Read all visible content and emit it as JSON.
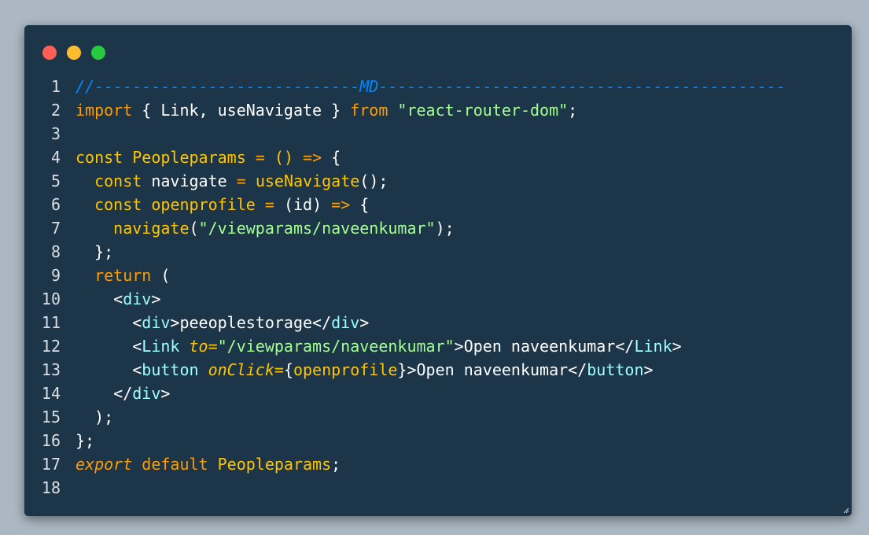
{
  "window": {
    "controls": [
      "close",
      "minimize",
      "maximize"
    ],
    "colors": {
      "background": "#1c3549",
      "page": "#abb8c3"
    }
  },
  "code": {
    "lines": [
      {
        "n": "1",
        "tokens": [
          {
            "t": "//----------------------------MD-------------------------------------------",
            "c": "comment"
          }
        ]
      },
      {
        "n": "2",
        "tokens": [
          {
            "t": "import",
            "c": "keyword"
          },
          {
            "t": " { Link, useNavigate } ",
            "c": "plain"
          },
          {
            "t": "from",
            "c": "keyword"
          },
          {
            "t": " ",
            "c": "plain"
          },
          {
            "t": "\"react-router-dom\"",
            "c": "string"
          },
          {
            "t": ";",
            "c": "plain"
          }
        ]
      },
      {
        "n": "3",
        "tokens": []
      },
      {
        "n": "4",
        "tokens": [
          {
            "t": "const",
            "c": "func"
          },
          {
            "t": " ",
            "c": "plain"
          },
          {
            "t": "Peopleparams",
            "c": "func"
          },
          {
            "t": " ",
            "c": "plain"
          },
          {
            "t": "=",
            "c": "op"
          },
          {
            "t": " () ",
            "c": "func"
          },
          {
            "t": "=>",
            "c": "op"
          },
          {
            "t": " {",
            "c": "plain"
          }
        ]
      },
      {
        "n": "5",
        "tokens": [
          {
            "t": "  ",
            "c": "plain"
          },
          {
            "t": "const",
            "c": "func"
          },
          {
            "t": " navigate ",
            "c": "plain"
          },
          {
            "t": "=",
            "c": "op"
          },
          {
            "t": " ",
            "c": "plain"
          },
          {
            "t": "useNavigate",
            "c": "func"
          },
          {
            "t": "();",
            "c": "plain"
          }
        ]
      },
      {
        "n": "6",
        "tokens": [
          {
            "t": "  ",
            "c": "plain"
          },
          {
            "t": "const",
            "c": "func"
          },
          {
            "t": " ",
            "c": "plain"
          },
          {
            "t": "openprofile",
            "c": "func"
          },
          {
            "t": " ",
            "c": "plain"
          },
          {
            "t": "=",
            "c": "op"
          },
          {
            "t": " (id) ",
            "c": "plain"
          },
          {
            "t": "=>",
            "c": "op"
          },
          {
            "t": " {",
            "c": "plain"
          }
        ]
      },
      {
        "n": "7",
        "tokens": [
          {
            "t": "    ",
            "c": "plain"
          },
          {
            "t": "navigate",
            "c": "func"
          },
          {
            "t": "(",
            "c": "plain"
          },
          {
            "t": "\"/viewparams/naveenkumar\"",
            "c": "string"
          },
          {
            "t": ");",
            "c": "plain"
          }
        ]
      },
      {
        "n": "8",
        "tokens": [
          {
            "t": "  };",
            "c": "plain"
          }
        ]
      },
      {
        "n": "9",
        "tokens": [
          {
            "t": "  ",
            "c": "plain"
          },
          {
            "t": "return",
            "c": "keyword"
          },
          {
            "t": " (",
            "c": "plain"
          }
        ]
      },
      {
        "n": "10",
        "tokens": [
          {
            "t": "    <",
            "c": "plain"
          },
          {
            "t": "div",
            "c": "tag"
          },
          {
            "t": ">",
            "c": "plain"
          }
        ]
      },
      {
        "n": "11",
        "tokens": [
          {
            "t": "      <",
            "c": "plain"
          },
          {
            "t": "div",
            "c": "tag"
          },
          {
            "t": ">peeoplestorage</",
            "c": "plain"
          },
          {
            "t": "div",
            "c": "tag"
          },
          {
            "t": ">",
            "c": "plain"
          }
        ]
      },
      {
        "n": "12",
        "tokens": [
          {
            "t": "      <",
            "c": "plain"
          },
          {
            "t": "Link",
            "c": "tag"
          },
          {
            "t": " ",
            "c": "plain"
          },
          {
            "t": "to=",
            "c": "attr"
          },
          {
            "t": "\"/viewparams/naveenkumar\"",
            "c": "string"
          },
          {
            "t": ">Open naveenkumar</",
            "c": "plain"
          },
          {
            "t": "Link",
            "c": "tag"
          },
          {
            "t": ">",
            "c": "plain"
          }
        ]
      },
      {
        "n": "13",
        "tokens": [
          {
            "t": "      <",
            "c": "plain"
          },
          {
            "t": "button",
            "c": "tag"
          },
          {
            "t": " ",
            "c": "plain"
          },
          {
            "t": "onClick=",
            "c": "attr"
          },
          {
            "t": "{",
            "c": "plain"
          },
          {
            "t": "openprofile",
            "c": "func"
          },
          {
            "t": "}>Open naveenkumar</",
            "c": "plain"
          },
          {
            "t": "button",
            "c": "tag"
          },
          {
            "t": ">",
            "c": "plain"
          }
        ]
      },
      {
        "n": "14",
        "tokens": [
          {
            "t": "    </",
            "c": "plain"
          },
          {
            "t": "div",
            "c": "tag"
          },
          {
            "t": ">",
            "c": "plain"
          }
        ]
      },
      {
        "n": "15",
        "tokens": [
          {
            "t": "  );",
            "c": "plain"
          }
        ]
      },
      {
        "n": "16",
        "tokens": [
          {
            "t": "};",
            "c": "plain"
          }
        ]
      },
      {
        "n": "17",
        "tokens": [
          {
            "t": "export",
            "c": "keyword-it"
          },
          {
            "t": " ",
            "c": "plain"
          },
          {
            "t": "default",
            "c": "keyword"
          },
          {
            "t": " ",
            "c": "plain"
          },
          {
            "t": "Peopleparams",
            "c": "func"
          },
          {
            "t": ";",
            "c": "plain"
          }
        ]
      },
      {
        "n": "18",
        "tokens": []
      }
    ]
  }
}
